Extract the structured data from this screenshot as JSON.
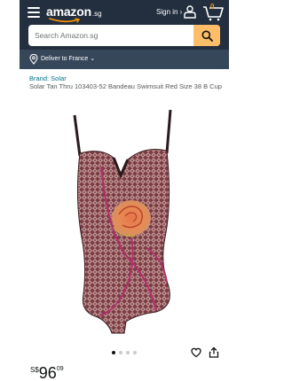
{
  "header": {
    "logo_text": "amazon",
    "logo_tld": ".sg",
    "signin_label": "Sign in ›",
    "cart_count": "0",
    "search_placeholder": "Search Amazon.sg",
    "deliver_text": "Deliver to France ⌄"
  },
  "product": {
    "brand": "Brand: Solar",
    "title": "Solar Tan Thru 103403-52 Bandeau Swimsuit Red Size 38 B Cup",
    "carousel_dots": 4,
    "carousel_active_index": 0,
    "price": {
      "symbol": "S$",
      "whole": "96",
      "fraction": "09"
    }
  },
  "colors": {
    "header_bg": "#232F3E",
    "deliver_bg": "#37475A",
    "search_button": "#FEBD69",
    "link": "#007185",
    "cart_count": "#FF9900"
  }
}
